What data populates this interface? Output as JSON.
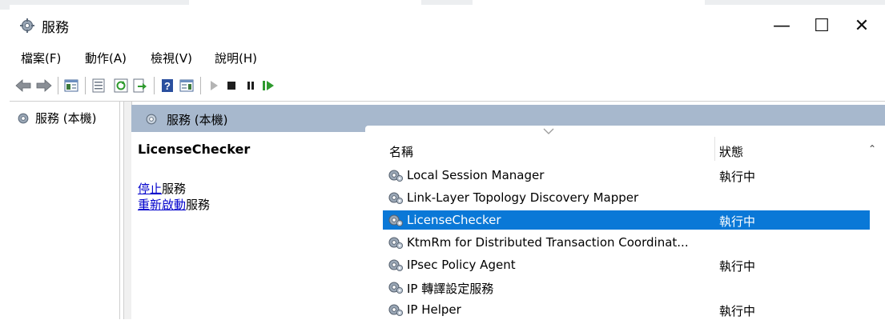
{
  "window": {
    "title": "服務",
    "title_icon": "gear-icon",
    "controls": {
      "minimize": "—",
      "maximize": "☐",
      "close": "✕"
    }
  },
  "menu": [
    "檔案(F)",
    "動作(A)",
    "檢視(V)",
    "說明(H)"
  ],
  "toolbar": [
    "back-arrow-icon",
    "forward-arrow-icon",
    "show-hide-tree-icon",
    "properties-icon",
    "refresh-icon",
    "export-list-icon",
    "help-icon",
    "show-hide-action-pane-icon",
    "play-icon",
    "stop-icon",
    "pause-icon",
    "restart-icon"
  ],
  "tree": {
    "label": "服務 (本機)"
  },
  "panel": {
    "header": "服務 (本機)"
  },
  "description": {
    "service_name": "LicenseChecker",
    "actions": [
      {
        "link": "停止",
        "text": "服務"
      },
      {
        "link": "重新啟動",
        "text": "服務"
      }
    ]
  },
  "list": {
    "columns": {
      "name": "名稱",
      "status": "狀態"
    },
    "rows": [
      {
        "name": "Local Session Manager",
        "status": "執行中"
      },
      {
        "name": "Link-Layer Topology Discovery Mapper",
        "status": ""
      },
      {
        "name": "LicenseChecker",
        "status": "執行中",
        "selected": true
      },
      {
        "name": "KtmRm for Distributed Transaction Coordinat...",
        "status": ""
      },
      {
        "name": "IPsec Policy Agent",
        "status": "執行中"
      },
      {
        "name": "IP 轉譯設定服務",
        "status": ""
      },
      {
        "name": "IP Helper",
        "status": "執行中"
      }
    ]
  },
  "colors": {
    "header_band": "#a7b8cd",
    "selection": "#0a78d7",
    "link": "#0000cc"
  }
}
